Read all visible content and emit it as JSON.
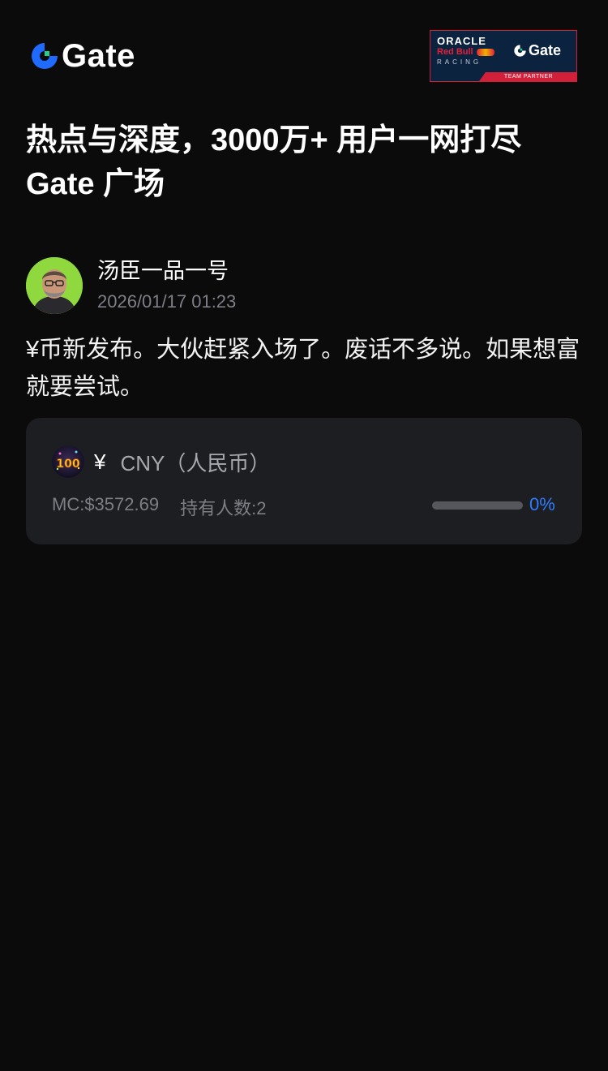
{
  "brand": {
    "name": "Gate",
    "accent": "#1f6bff",
    "accent_green": "#1ed28c"
  },
  "partner_badge": {
    "oracle": "ORACLE",
    "redbull": "Red Bull",
    "racing": "RACING",
    "gate": "Gate",
    "team_partner": "TEAM PARTNER"
  },
  "headline": {
    "line1": "热点与深度，3000万+ 用户一网打尽",
    "line2": "Gate 广场"
  },
  "post": {
    "author": "汤臣一品一号",
    "time": "2026/01/17 01:23",
    "body": "¥币新发布。大伙赶紧入场了。废话不多说。如果想富就要尝试。"
  },
  "coin_card": {
    "symbol": "¥",
    "name": "CNY（人民币）",
    "icon_text": "100",
    "market_cap": "MC:$3572.69",
    "holders": "持有人数:2",
    "progress_fraction": 0,
    "progress_label": "0%"
  }
}
